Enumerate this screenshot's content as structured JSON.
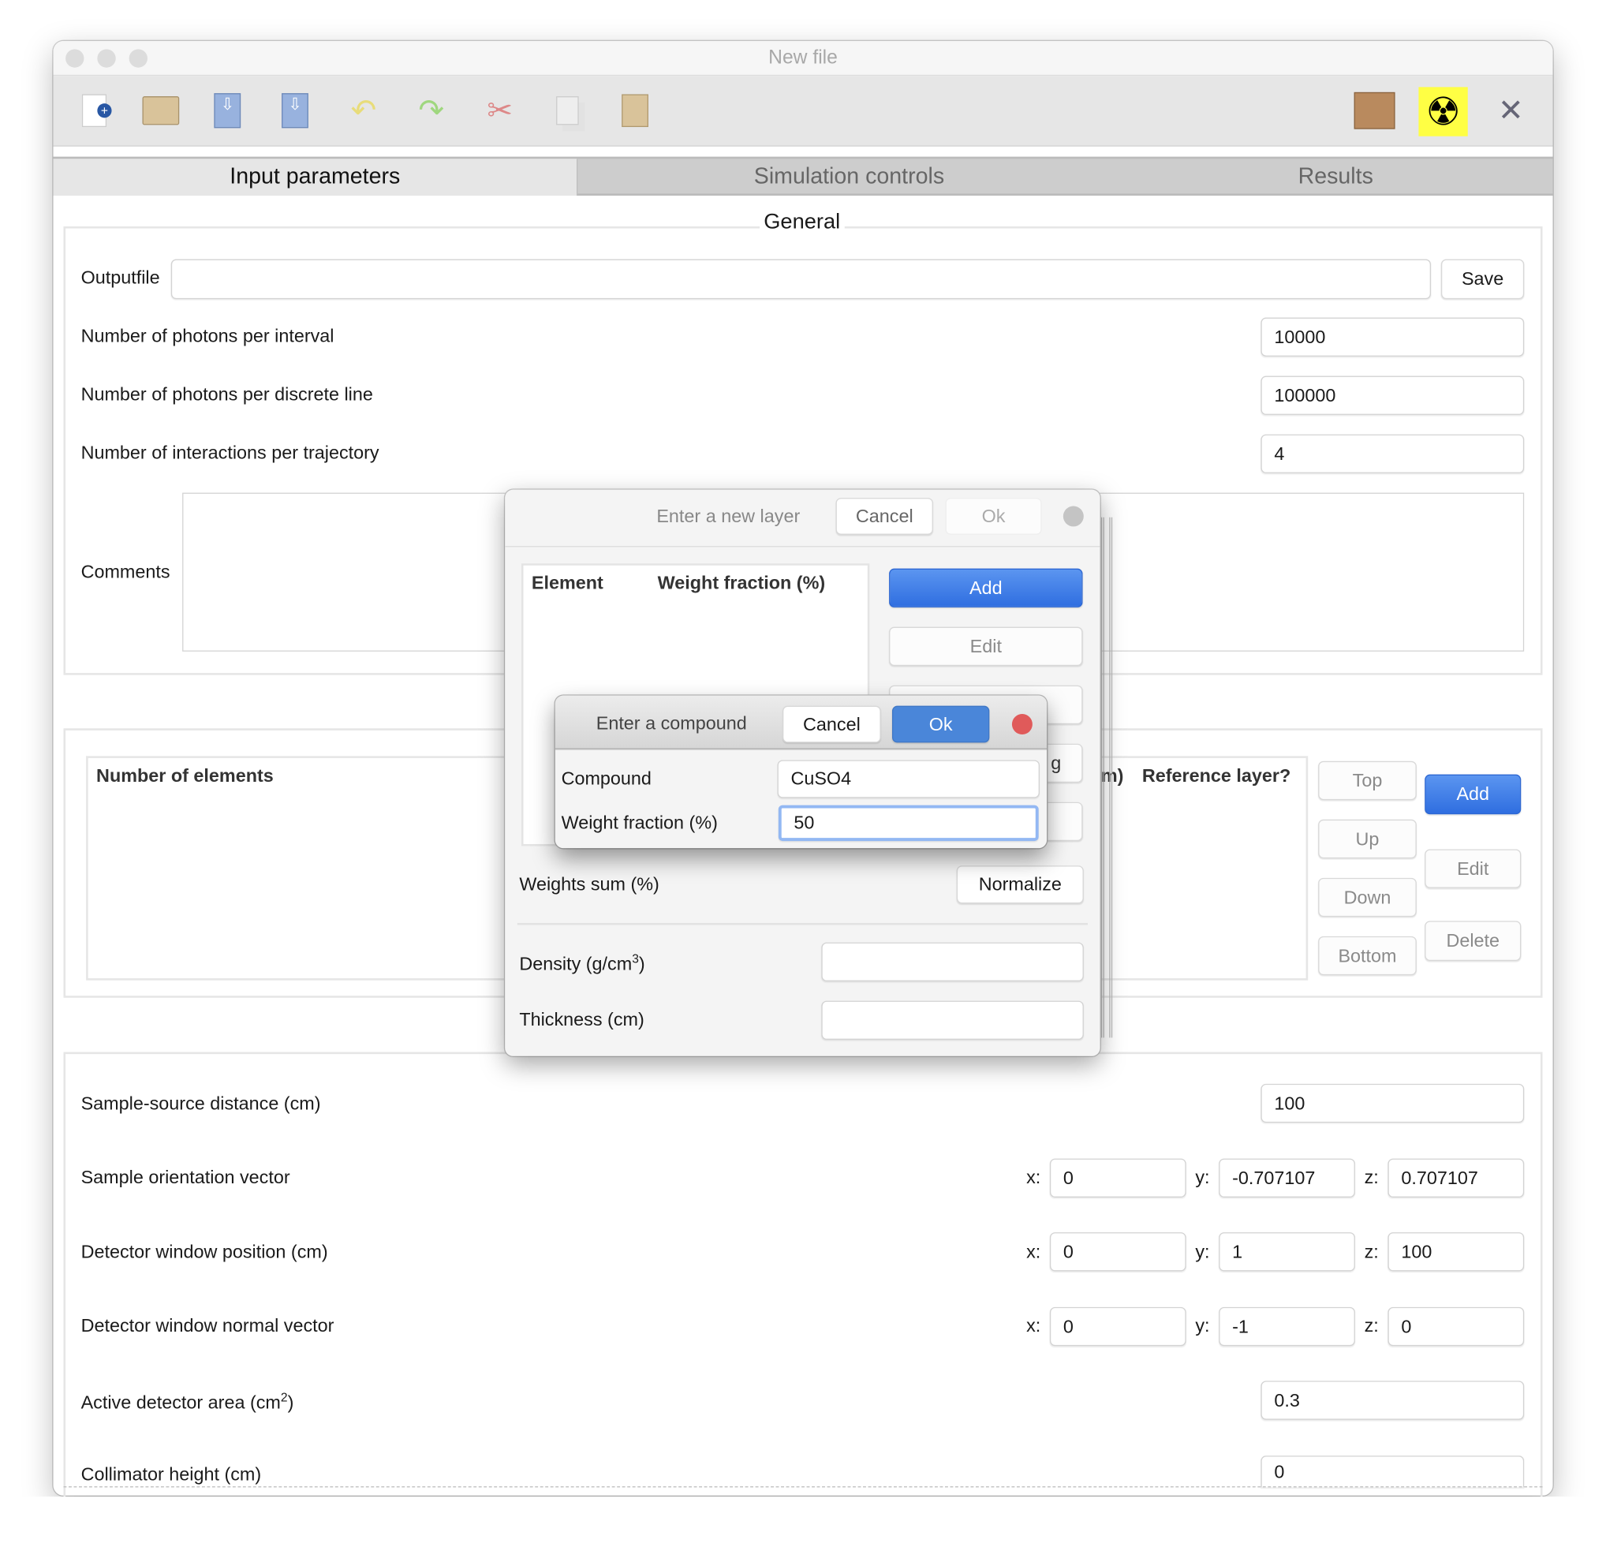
{
  "window": {
    "title": "New file"
  },
  "toolbar": {
    "icons": [
      "new-file-icon",
      "open-folder-icon",
      "save-icon",
      "save-as-icon",
      "undo-icon",
      "redo-icon",
      "cut-icon",
      "copy-icon",
      "paste-icon",
      "package-icon",
      "radiation-icon",
      "tools-icon"
    ]
  },
  "tabs": [
    {
      "label": "Input parameters",
      "selected": true
    },
    {
      "label": "Simulation controls"
    },
    {
      "label": "Results"
    }
  ],
  "general": {
    "title": "General",
    "outputfile_label": "Outputfile",
    "outputfile_value": "",
    "save_label": "Save",
    "photons_interval_label": "Number of photons per interval",
    "photons_interval": "10000",
    "photons_line_label": "Number of photons per discrete line",
    "photons_line": "100000",
    "interactions_label": "Number of interactions per trajectory",
    "interactions": "4",
    "comments_label": "Comments",
    "comments": ""
  },
  "layers": {
    "col_elements": "Number of elements",
    "col_partial": "m)",
    "col_reference": "Reference layer?",
    "top": "Top",
    "up": "Up",
    "down": "Down",
    "bottom": "Bottom",
    "add": "Add",
    "edit": "Edit",
    "delete": "Delete"
  },
  "geometry": {
    "distance_label": "Sample-source distance (cm)",
    "distance": "100",
    "orientation_label": "Sample orientation vector",
    "orientation": {
      "x": "0",
      "y": "-0.707107",
      "z": "0.707107"
    },
    "det_pos_label": "Detector window position (cm)",
    "det_pos": {
      "x": "0",
      "y": "1",
      "z": "100"
    },
    "det_normal_label": "Detector window normal vector",
    "det_normal": {
      "x": "0",
      "y": "-1",
      "z": "0"
    },
    "area_label": "Active detector area (cm",
    "area_sup": "2",
    "area_close": ")",
    "area": "0.3",
    "collimator_label": "Collimator height (cm)",
    "collimator": "0",
    "x": "x:",
    "y": "y:",
    "z": "z:"
  },
  "layer_dialog": {
    "title": "Enter a new layer",
    "cancel": "Cancel",
    "ok": "Ok",
    "col_element": "Element",
    "col_weight": "Weight fraction (%)",
    "add": "Add",
    "edit": "Edit",
    "partial_button": "g",
    "weights_sum_label": "Weights sum (%)",
    "normalize": "Normalize",
    "density_label": "Density (g/cm",
    "density_sup": "3",
    "density_close": ")",
    "density": "",
    "thickness_label": "Thickness (cm)",
    "thickness": ""
  },
  "compound_dialog": {
    "title": "Enter a compound",
    "cancel": "Cancel",
    "ok": "Ok",
    "compound_label": "Compound",
    "compound": "CuSO4",
    "weight_label": "Weight fraction (%)",
    "weight": "50"
  },
  "colors": {
    "accent": "#2f6ee0",
    "ok_blue": "#4a86d9",
    "close_red": "#e05a5a",
    "radiation_bg": "#ffff44"
  }
}
